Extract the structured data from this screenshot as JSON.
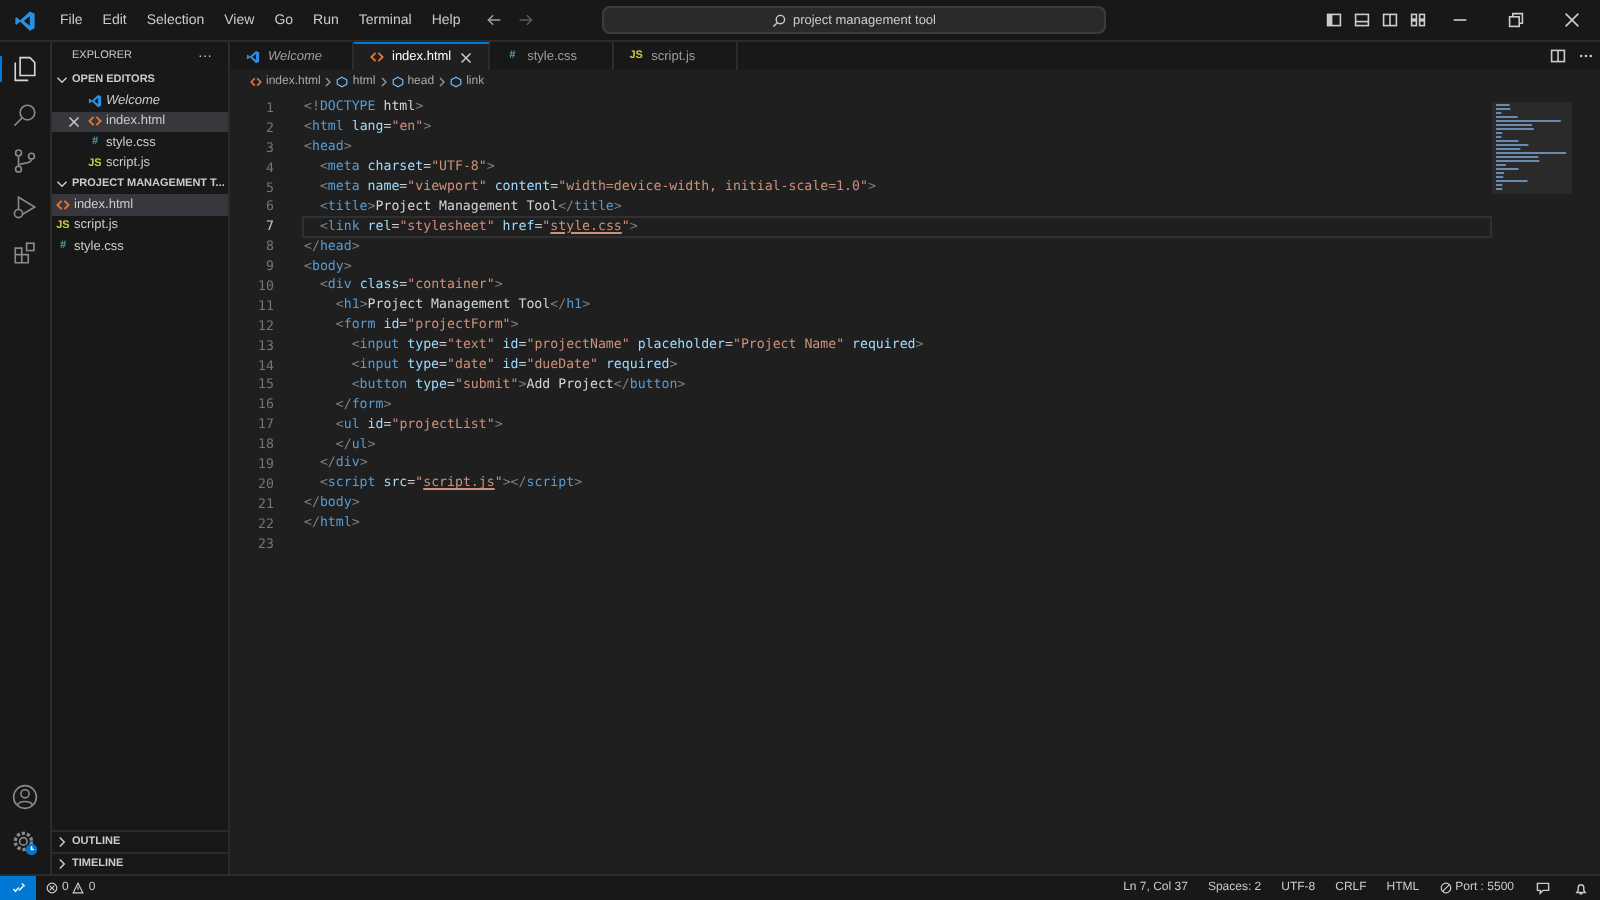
{
  "title_bar": {
    "menu": [
      "File",
      "Edit",
      "Selection",
      "View",
      "Go",
      "Run",
      "Terminal",
      "Help"
    ],
    "search": "project management tool"
  },
  "sidebar": {
    "title": "EXPLORER",
    "more": "···",
    "sections": [
      {
        "label": "OPEN EDITORS",
        "expanded": true,
        "items": [
          {
            "name": "Welcome",
            "kind": "welcome",
            "italic": true,
            "selected": false
          },
          {
            "name": "index.html",
            "kind": "html",
            "italic": false,
            "selected": true
          },
          {
            "name": "style.css",
            "kind": "css",
            "icon_text": "#",
            "italic": false,
            "selected": false
          },
          {
            "name": "script.js",
            "kind": "js",
            "icon_text": "JS",
            "italic": false,
            "selected": false
          }
        ]
      },
      {
        "label": "PROJECT MANAGEMENT T...",
        "expanded": true,
        "items": [
          {
            "name": "index.html",
            "kind": "html",
            "italic": false,
            "selected": true
          },
          {
            "name": "script.js",
            "kind": "js",
            "icon_text": "JS",
            "italic": false,
            "selected": false
          },
          {
            "name": "style.css",
            "kind": "css",
            "icon_text": "#",
            "italic": false,
            "selected": false
          }
        ]
      }
    ],
    "bottom_sections": [
      {
        "label": "OUTLINE",
        "expanded": false
      },
      {
        "label": "TIMELINE",
        "expanded": false
      }
    ]
  },
  "tabs": [
    {
      "name": "Welcome",
      "kind": "welcome",
      "italic": true,
      "selected": false
    },
    {
      "name": "index.html",
      "kind": "html",
      "italic": false,
      "selected": true
    },
    {
      "name": "style.css",
      "kind": "css",
      "icon_text": "#",
      "italic": false,
      "selected": false
    },
    {
      "name": "script.js",
      "kind": "js",
      "icon_text": "JS",
      "italic": false,
      "selected": false
    }
  ],
  "breadcrumb": [
    "index.html",
    "html",
    "head",
    "link"
  ],
  "code": [
    {
      "n": "1",
      "current": false,
      "t": [
        {
          "kind": "p",
          "text": "<!"
        },
        {
          "kind": "tag",
          "text": "DOCTYPE"
        },
        {
          "kind": "text",
          "text": " html"
        },
        {
          "kind": "p",
          "text": ">"
        }
      ]
    },
    {
      "n": "2",
      "current": false,
      "t": [
        {
          "kind": "p",
          "text": "<"
        },
        {
          "kind": "tag",
          "text": "html"
        },
        {
          "kind": "attr",
          "text": " lang"
        },
        {
          "kind": "text",
          "text": "="
        },
        {
          "kind": "str",
          "text": "\"en\""
        },
        {
          "kind": "p",
          "text": ">"
        }
      ]
    },
    {
      "n": "3",
      "current": false,
      "t": [
        {
          "kind": "p",
          "text": "<"
        },
        {
          "kind": "tag",
          "text": "head"
        },
        {
          "kind": "p",
          "text": ">"
        }
      ]
    },
    {
      "n": "4",
      "current": false,
      "t": [
        {
          "kind": "p",
          "text": "  <"
        },
        {
          "kind": "tag",
          "text": "meta"
        },
        {
          "kind": "attr",
          "text": " charset"
        },
        {
          "kind": "text",
          "text": "="
        },
        {
          "kind": "str",
          "text": "\"UTF-8\""
        },
        {
          "kind": "p",
          "text": ">"
        }
      ]
    },
    {
      "n": "5",
      "current": false,
      "t": [
        {
          "kind": "p",
          "text": "  <"
        },
        {
          "kind": "tag",
          "text": "meta"
        },
        {
          "kind": "attr",
          "text": " name"
        },
        {
          "kind": "text",
          "text": "="
        },
        {
          "kind": "str",
          "text": "\"viewport\""
        },
        {
          "kind": "attr",
          "text": " content"
        },
        {
          "kind": "text",
          "text": "="
        },
        {
          "kind": "str",
          "text": "\"width=device-width, initial-scale=1.0\""
        },
        {
          "kind": "p",
          "text": ">"
        }
      ]
    },
    {
      "n": "6",
      "current": false,
      "t": [
        {
          "kind": "p",
          "text": "  <"
        },
        {
          "kind": "tag",
          "text": "title"
        },
        {
          "kind": "p",
          "text": ">"
        },
        {
          "kind": "text",
          "text": "Project Management Tool"
        },
        {
          "kind": "p",
          "text": "</"
        },
        {
          "kind": "tag",
          "text": "title"
        },
        {
          "kind": "p",
          "text": ">"
        }
      ]
    },
    {
      "n": "7",
      "current": true,
      "t": [
        {
          "kind": "p",
          "text": "  <"
        },
        {
          "kind": "tag",
          "text": "link"
        },
        {
          "kind": "attr",
          "text": " rel"
        },
        {
          "kind": "text",
          "text": "="
        },
        {
          "kind": "str",
          "text": "\"stylesheet\""
        },
        {
          "kind": "attr",
          "text": " href"
        },
        {
          "kind": "text",
          "text": "="
        },
        {
          "kind": "str",
          "text": "\""
        },
        {
          "kind": "link",
          "text": "style.css"
        },
        {
          "kind": "str",
          "text": "\""
        },
        {
          "kind": "p",
          "text": ">"
        }
      ]
    },
    {
      "n": "8",
      "current": false,
      "t": [
        {
          "kind": "p",
          "text": "</"
        },
        {
          "kind": "tag",
          "text": "head"
        },
        {
          "kind": "p",
          "text": ">"
        }
      ]
    },
    {
      "n": "9",
      "current": false,
      "t": [
        {
          "kind": "p",
          "text": "<"
        },
        {
          "kind": "tag",
          "text": "body"
        },
        {
          "kind": "p",
          "text": ">"
        }
      ]
    },
    {
      "n": "10",
      "current": false,
      "t": [
        {
          "kind": "p",
          "text": "  <"
        },
        {
          "kind": "tag",
          "text": "div"
        },
        {
          "kind": "attr",
          "text": " class"
        },
        {
          "kind": "text",
          "text": "="
        },
        {
          "kind": "str",
          "text": "\"container\""
        },
        {
          "kind": "p",
          "text": ">"
        }
      ]
    },
    {
      "n": "11",
      "current": false,
      "t": [
        {
          "kind": "p",
          "text": "    <"
        },
        {
          "kind": "tag",
          "text": "h1"
        },
        {
          "kind": "p",
          "text": ">"
        },
        {
          "kind": "text",
          "text": "Project Management Tool"
        },
        {
          "kind": "p",
          "text": "</"
        },
        {
          "kind": "tag",
          "text": "h1"
        },
        {
          "kind": "p",
          "text": ">"
        }
      ]
    },
    {
      "n": "12",
      "current": false,
      "t": [
        {
          "kind": "p",
          "text": "    <"
        },
        {
          "kind": "tag",
          "text": "form"
        },
        {
          "kind": "attr",
          "text": " id"
        },
        {
          "kind": "text",
          "text": "="
        },
        {
          "kind": "str",
          "text": "\"projectForm\""
        },
        {
          "kind": "p",
          "text": ">"
        }
      ]
    },
    {
      "n": "13",
      "current": false,
      "t": [
        {
          "kind": "p",
          "text": "      <"
        },
        {
          "kind": "tag",
          "text": "input"
        },
        {
          "kind": "attr",
          "text": " type"
        },
        {
          "kind": "text",
          "text": "="
        },
        {
          "kind": "str",
          "text": "\"text\""
        },
        {
          "kind": "attr",
          "text": " id"
        },
        {
          "kind": "text",
          "text": "="
        },
        {
          "kind": "str",
          "text": "\"projectName\""
        },
        {
          "kind": "attr",
          "text": " placeholder"
        },
        {
          "kind": "text",
          "text": "="
        },
        {
          "kind": "str",
          "text": "\"Project Name\""
        },
        {
          "kind": "attr",
          "text": " required"
        },
        {
          "kind": "p",
          "text": ">"
        }
      ]
    },
    {
      "n": "14",
      "current": false,
      "t": [
        {
          "kind": "p",
          "text": "      <"
        },
        {
          "kind": "tag",
          "text": "input"
        },
        {
          "kind": "attr",
          "text": " type"
        },
        {
          "kind": "text",
          "text": "="
        },
        {
          "kind": "str",
          "text": "\"date\""
        },
        {
          "kind": "attr",
          "text": " id"
        },
        {
          "kind": "text",
          "text": "="
        },
        {
          "kind": "str",
          "text": "\"dueDate\""
        },
        {
          "kind": "attr",
          "text": " required"
        },
        {
          "kind": "p",
          "text": ">"
        }
      ]
    },
    {
      "n": "15",
      "current": false,
      "t": [
        {
          "kind": "p",
          "text": "      <"
        },
        {
          "kind": "tag",
          "text": "button"
        },
        {
          "kind": "attr",
          "text": " type"
        },
        {
          "kind": "text",
          "text": "="
        },
        {
          "kind": "str",
          "text": "\"submit\""
        },
        {
          "kind": "p",
          "text": ">"
        },
        {
          "kind": "text",
          "text": "Add Project"
        },
        {
          "kind": "p",
          "text": "</"
        },
        {
          "kind": "tag",
          "text": "button"
        },
        {
          "kind": "p",
          "text": ">"
        }
      ]
    },
    {
      "n": "16",
      "current": false,
      "t": [
        {
          "kind": "p",
          "text": "    </"
        },
        {
          "kind": "tag",
          "text": "form"
        },
        {
          "kind": "p",
          "text": ">"
        }
      ]
    },
    {
      "n": "17",
      "current": false,
      "t": [
        {
          "kind": "p",
          "text": "    <"
        },
        {
          "kind": "tag",
          "text": "ul"
        },
        {
          "kind": "attr",
          "text": " id"
        },
        {
          "kind": "text",
          "text": "="
        },
        {
          "kind": "str",
          "text": "\"projectList\""
        },
        {
          "kind": "p",
          "text": ">"
        }
      ]
    },
    {
      "n": "18",
      "current": false,
      "t": [
        {
          "kind": "p",
          "text": "    </"
        },
        {
          "kind": "tag",
          "text": "ul"
        },
        {
          "kind": "p",
          "text": ">"
        }
      ]
    },
    {
      "n": "19",
      "current": false,
      "t": [
        {
          "kind": "p",
          "text": "  </"
        },
        {
          "kind": "tag",
          "text": "div"
        },
        {
          "kind": "p",
          "text": ">"
        }
      ]
    },
    {
      "n": "20",
      "current": false,
      "t": [
        {
          "kind": "p",
          "text": "  <"
        },
        {
          "kind": "tag",
          "text": "script"
        },
        {
          "kind": "attr",
          "text": " src"
        },
        {
          "kind": "text",
          "text": "="
        },
        {
          "kind": "str",
          "text": "\""
        },
        {
          "kind": "link",
          "text": "script.js"
        },
        {
          "kind": "str",
          "text": "\""
        },
        {
          "kind": "p",
          "text": "></"
        },
        {
          "kind": "tag",
          "text": "script"
        },
        {
          "kind": "p",
          "text": ">"
        }
      ]
    },
    {
      "n": "21",
      "current": false,
      "t": [
        {
          "kind": "p",
          "text": "</"
        },
        {
          "kind": "tag",
          "text": "body"
        },
        {
          "kind": "p",
          "text": ">"
        }
      ]
    },
    {
      "n": "22",
      "current": false,
      "t": [
        {
          "kind": "p",
          "text": "</"
        },
        {
          "kind": "tag",
          "text": "html"
        },
        {
          "kind": "p",
          "text": ">"
        }
      ]
    },
    {
      "n": "23",
      "current": false
    }
  ],
  "status_bar": {
    "errors": "0",
    "warnings": "0",
    "right": [
      "Ln 7, Col 37",
      "Spaces: 2",
      "UTF-8",
      "CRLF",
      "HTML"
    ],
    "port": "Port : 5500"
  }
}
